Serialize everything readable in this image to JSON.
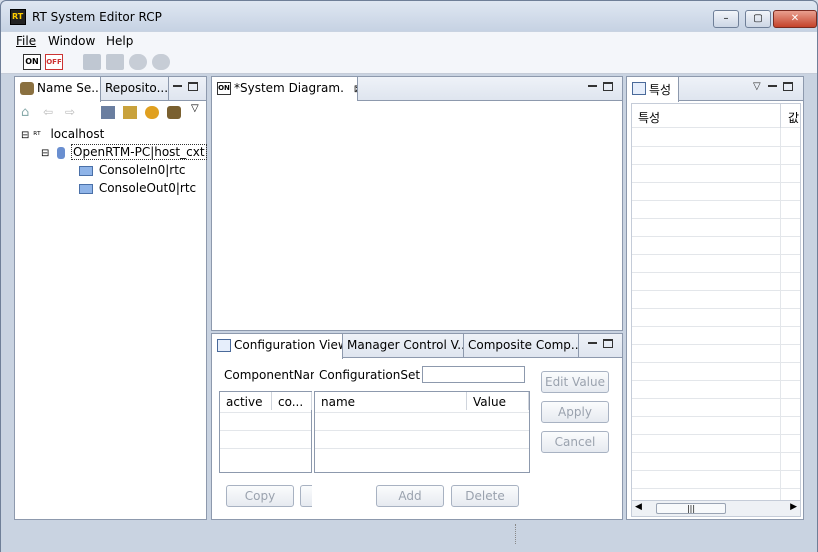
{
  "window": {
    "title": "RT System Editor RCP",
    "min": "–",
    "max": "▢",
    "close": "✕"
  },
  "menu": [
    "File",
    "Window",
    "Help"
  ],
  "left_panel": {
    "tabs": [
      "Name Se...",
      "Reposito..."
    ],
    "tree": {
      "root": "localhost",
      "context": "OpenRTM-PC|host_cxt",
      "children": [
        "ConsoleIn0|rtc",
        "ConsoleOut0|rtc"
      ]
    }
  },
  "diagram": {
    "tab": "*System Diagram."
  },
  "bottom": {
    "tabs": [
      "Configuration View",
      "Manager Control V...",
      "Composite Comp..."
    ],
    "component_name_label": "ComponentNam",
    "config_set_label": "ConfigurationSet :",
    "config_set_value": "",
    "left_table_headers": [
      "active",
      "co..."
    ],
    "right_table_headers": [
      "name",
      "Value"
    ],
    "buttons": {
      "edit_value": "Edit Value",
      "apply": "Apply",
      "cancel": "Cancel",
      "copy": "Copy",
      "add": "Add",
      "delete": "Delete"
    }
  },
  "properties": {
    "tab": "특성",
    "col1": "특성",
    "col2": "값"
  }
}
